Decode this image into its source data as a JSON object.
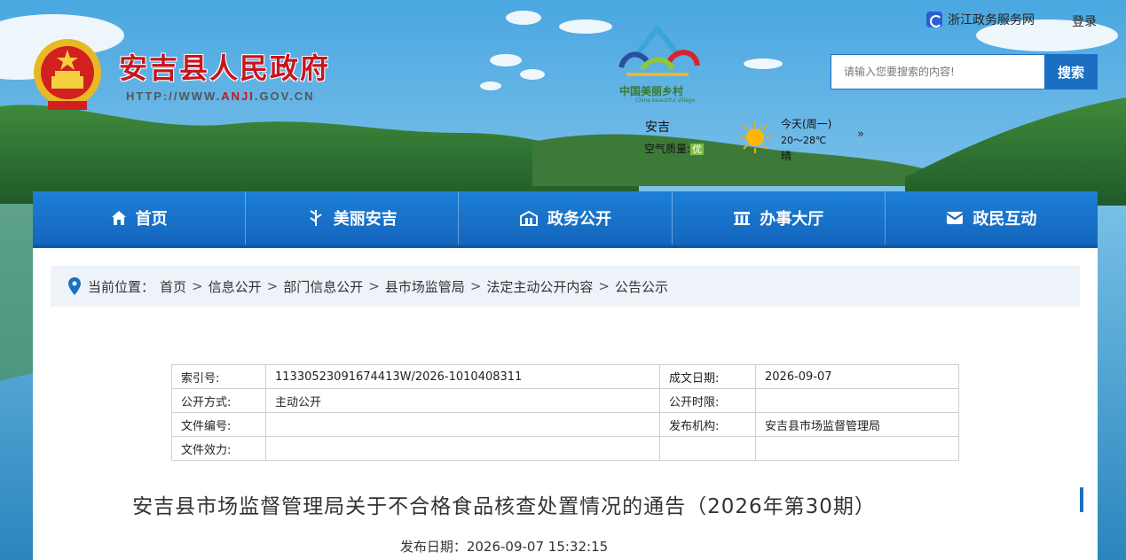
{
  "header": {
    "site_title": "安吉县人民政府",
    "url_prefix": "HTTP://WWW.",
    "url_highlight": "ANJI",
    "url_suffix": ".GOV.CN",
    "village_logo_text": "中国美丽乡村",
    "village_logo_sub": "China beautiful village",
    "zj_service_link": "浙江政务服务网",
    "login": "登录",
    "search_placeholder": "请输入您要搜索的内容!",
    "search_button": "搜索"
  },
  "weather": {
    "city": "安吉",
    "air_label": "空气质量:",
    "air_value": "优",
    "day": "今天(周一)",
    "temp": "20～28℃",
    "condition": "晴",
    "more": "»",
    "icon": "sun-icon"
  },
  "nav": [
    {
      "label": "首页",
      "icon": "home-icon"
    },
    {
      "label": "美丽安吉",
      "icon": "bamboo-icon"
    },
    {
      "label": "政务公开",
      "icon": "government-icon"
    },
    {
      "label": "办事大厅",
      "icon": "hall-icon"
    },
    {
      "label": "政民互动",
      "icon": "mail-icon"
    }
  ],
  "breadcrumb": {
    "label": "当前位置：",
    "items": [
      "首页",
      "信息公开",
      "部门信息公开",
      "县市场监管局",
      "法定主动公开内容",
      "公告公示"
    ],
    "separator": ">"
  },
  "meta": {
    "index_label": "索引号:",
    "index_value": "11330523091674413W/2026-1010408311",
    "date_label": "成文日期:",
    "date_value": "2026-09-07",
    "mode_label": "公开方式:",
    "mode_value": "主动公开",
    "limit_label": "公开时限:",
    "limit_value": "",
    "docno_label": "文件编号:",
    "docno_value": "",
    "org_label": "发布机构:",
    "org_value": "安吉县市场监督管理局",
    "valid_label": "文件效力:",
    "valid_value": ""
  },
  "document": {
    "title": "安吉县市场监督管理局关于不合格食品核查处置情况的通告（2026年第30期）",
    "publish_date": "发布日期：2026-09-07 15:32:15"
  },
  "colors": {
    "brand_red": "#c8161d",
    "nav_blue": "#1b6fc3",
    "crumb_bg": "#eef3f9"
  }
}
